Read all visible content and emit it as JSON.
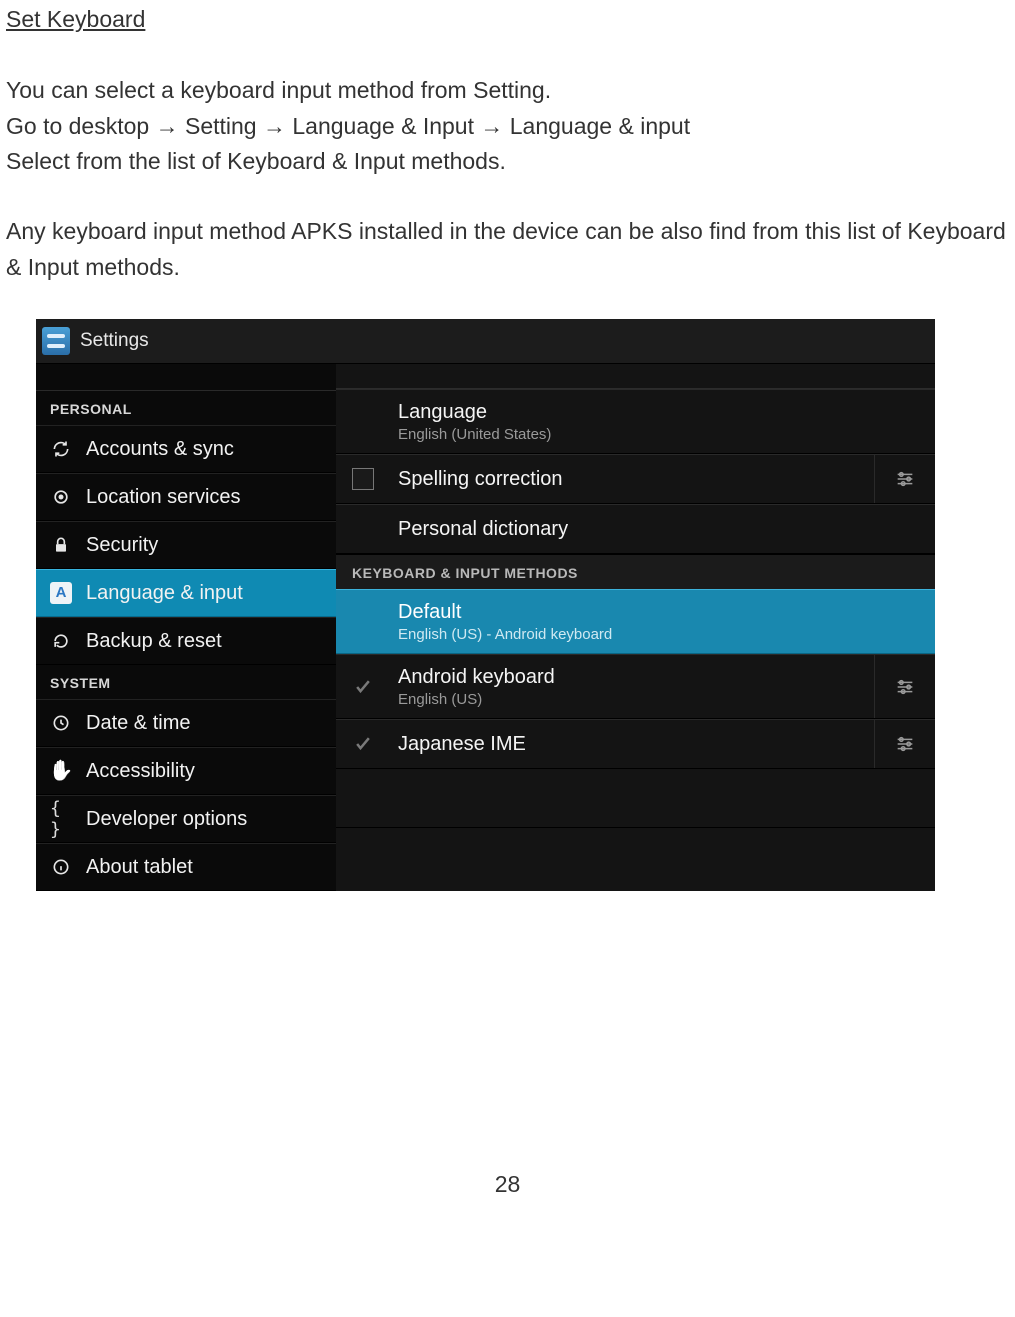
{
  "doc": {
    "heading": "Set Keyboard",
    "p1": "You can select a keyboard input method from Setting.\nGo to desktop → Setting → Language & Input → Language & input\nSelect from the list of Keyboard & Input methods.",
    "p2": "Any keyboard input method APKS installed in the device can be also find from this list of Keyboard & Input methods.",
    "page_number": "28"
  },
  "screenshot": {
    "titlebar": "Settings",
    "sidebar": {
      "personal_header": "PERSONAL",
      "system_header": "SYSTEM",
      "items": {
        "accounts": "Accounts & sync",
        "location": "Location services",
        "security": "Security",
        "language": "Language & input",
        "backup": "Backup & reset",
        "datetime": "Date & time",
        "a11y": "Accessibility",
        "dev": "Developer options",
        "about": "About tablet"
      }
    },
    "detail": {
      "language": {
        "title": "Language",
        "sub": "English (United States)"
      },
      "spelling": {
        "title": "Spelling correction"
      },
      "dictionary": {
        "title": "Personal dictionary"
      },
      "kb_header": "KEYBOARD & INPUT METHODS",
      "default": {
        "title": "Default",
        "sub": "English (US) - Android keyboard"
      },
      "android_kb": {
        "title": "Android keyboard",
        "sub": "English (US)"
      },
      "japanese": {
        "title": "Japanese IME"
      }
    }
  }
}
